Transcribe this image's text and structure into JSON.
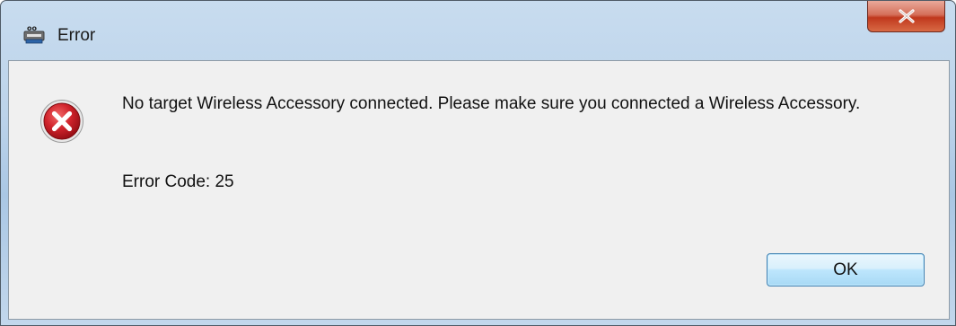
{
  "window": {
    "title": "Error",
    "close_label": "x"
  },
  "dialog": {
    "icon": "error-icon",
    "message": "No target Wireless Accessory connected. Please make sure you connected a Wireless Accessory.",
    "error_code": "Error Code: 25",
    "ok_label": "OK"
  },
  "colors": {
    "error_red": "#c8202b",
    "dialog_bg": "#f0f0f0",
    "close_red": "#c0381d",
    "button_blue": "#3c7fb1"
  }
}
